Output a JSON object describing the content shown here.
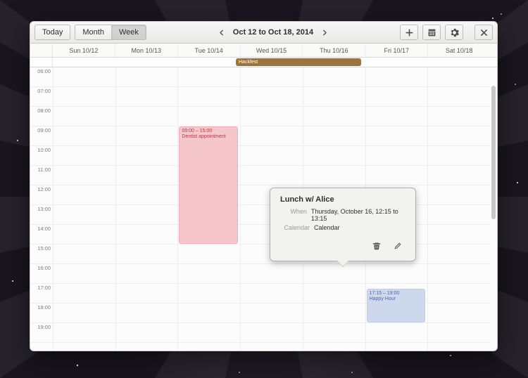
{
  "header": {
    "today_label": "Today",
    "month_label": "Month",
    "week_label": "Week",
    "date_range": "Oct 12 to Oct 18, 2014"
  },
  "days": [
    "Sun 10/12",
    "Mon 10/13",
    "Tue 10/14",
    "Wed 10/15",
    "Thu 10/16",
    "Fri 10/17",
    "Sat 10/18"
  ],
  "hours": [
    "06:00",
    "07:00",
    "08:00",
    "09:00",
    "10:00",
    "11:00",
    "12:00",
    "13:00",
    "14:00",
    "15:00",
    "16:00",
    "17:00",
    "18:00",
    "19:00"
  ],
  "allday": {
    "hackfest_label": "Hackfest"
  },
  "events": {
    "dentist": {
      "time": "09:00 – 15:00",
      "title": "Dentist appointment"
    },
    "lunch": {
      "time": "12:15 – 13:15",
      "title": "Lunch w/ Alice"
    },
    "happyhour": {
      "time": "17:15 – 19:00",
      "title": "Happy Hour"
    }
  },
  "popover": {
    "title": "Lunch w/ Alice",
    "when_key": "When",
    "when_val": "Thursday, October 16, 12:15 to 13:15",
    "cal_key": "Calendar",
    "cal_val": "Calendar"
  }
}
